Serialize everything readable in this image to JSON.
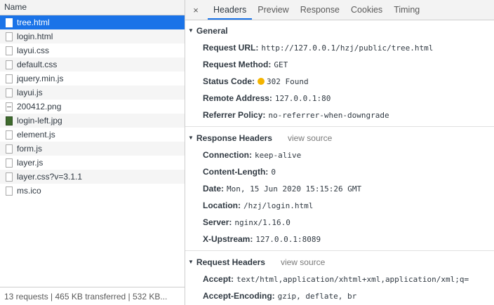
{
  "files": {
    "header": "Name",
    "items": [
      {
        "name": "tree.html",
        "icon": "file-icon",
        "selected": true
      },
      {
        "name": "login.html",
        "icon": "file-icon"
      },
      {
        "name": "layui.css",
        "icon": "file-icon"
      },
      {
        "name": "default.css",
        "icon": "file-icon"
      },
      {
        "name": "jquery.min.js",
        "icon": "file-icon"
      },
      {
        "name": "layui.js",
        "icon": "file-icon"
      },
      {
        "name": "200412.png",
        "icon": "image-icon"
      },
      {
        "name": "login-left.jpg",
        "icon": "jpg-image-icon"
      },
      {
        "name": "element.js",
        "icon": "file-icon"
      },
      {
        "name": "form.js",
        "icon": "file-icon"
      },
      {
        "name": "layer.js",
        "icon": "file-icon"
      },
      {
        "name": "layer.css?v=3.1.1",
        "icon": "file-icon"
      },
      {
        "name": "ms.ico",
        "icon": "file-icon"
      }
    ],
    "status": "13 requests  |  465 KB transferred  |  532 KB..."
  },
  "tabs": {
    "close": "×",
    "items": [
      "Headers",
      "Preview",
      "Response",
      "Cookies",
      "Timing"
    ],
    "active": "Headers"
  },
  "general": {
    "title": "General",
    "rows": [
      {
        "key": "Request URL:",
        "value": "http://127.0.0.1/hzj/public/tree.html"
      },
      {
        "key": "Request Method:",
        "value": "GET"
      },
      {
        "key": "Status Code:",
        "value": "302 Found",
        "dot": true
      },
      {
        "key": "Remote Address:",
        "value": "127.0.0.1:80"
      },
      {
        "key": "Referrer Policy:",
        "value": "no-referrer-when-downgrade"
      }
    ]
  },
  "response_headers": {
    "title": "Response Headers",
    "view_source": "view source",
    "rows": [
      {
        "key": "Connection:",
        "value": "keep-alive"
      },
      {
        "key": "Content-Length:",
        "value": "0"
      },
      {
        "key": "Date:",
        "value": "Mon, 15 Jun 2020 15:15:26 GMT"
      },
      {
        "key": "Location:",
        "value": "/hzj/login.html"
      },
      {
        "key": "Server:",
        "value": "nginx/1.16.0"
      },
      {
        "key": "X-Upstream:",
        "value": "127.0.0.1:8089"
      }
    ]
  },
  "request_headers": {
    "title": "Request Headers",
    "view_source": "view source",
    "rows": [
      {
        "key": "Accept:",
        "value": "text/html,application/xhtml+xml,application/xml;q="
      },
      {
        "key": "Accept-Encoding:",
        "value": "gzip, deflate, br"
      }
    ]
  },
  "colors": {
    "selected": "#1a73e8",
    "status_dot": "#f4b400"
  }
}
